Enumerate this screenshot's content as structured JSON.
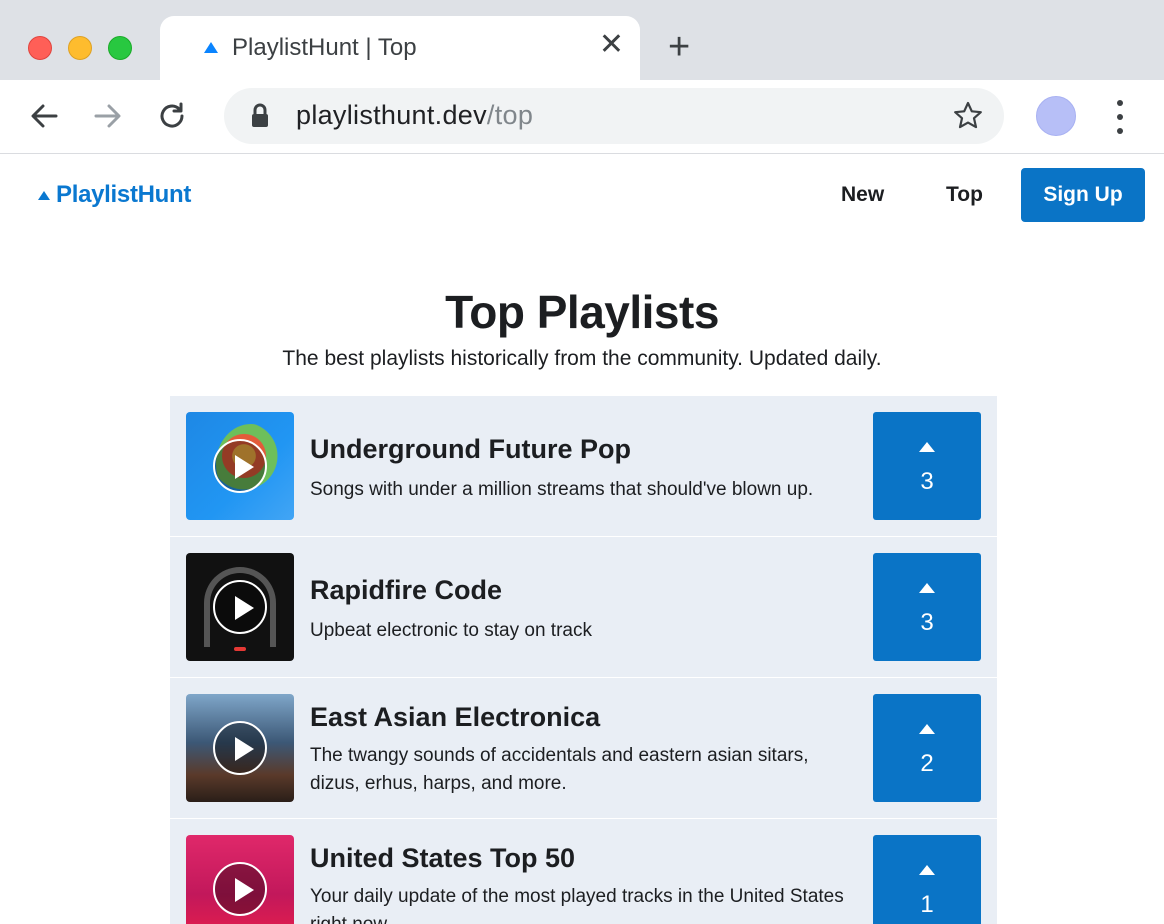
{
  "browser": {
    "tab_title": "PlaylistHunt | Top",
    "url_domain": "playlisthunt.dev",
    "url_path": "/top"
  },
  "site": {
    "brand": "PlaylistHunt",
    "nav": {
      "new": "New",
      "top": "Top",
      "signup": "Sign Up"
    }
  },
  "main": {
    "title": "Top Playlists",
    "subtitle": "The best playlists historically from the community. Updated daily."
  },
  "playlists": [
    {
      "title": "Underground Future Pop",
      "description": "Songs with under a million streams that should've blown up.",
      "votes": "3"
    },
    {
      "title": "Rapidfire Code",
      "description": "Upbeat electronic to stay on track",
      "votes": "3"
    },
    {
      "title": "East Asian Electronica",
      "description": "The twangy sounds of accidentals and eastern asian sitars, dizus, erhus, harps, and more.",
      "votes": "2"
    },
    {
      "title": "United States Top 50",
      "description": "Your daily update of the most played tracks in the United States right now.",
      "votes": "1"
    }
  ],
  "colors": {
    "brand": "#0a78d0",
    "button": "#0a74c6",
    "row_bg": "#e9eef5"
  }
}
